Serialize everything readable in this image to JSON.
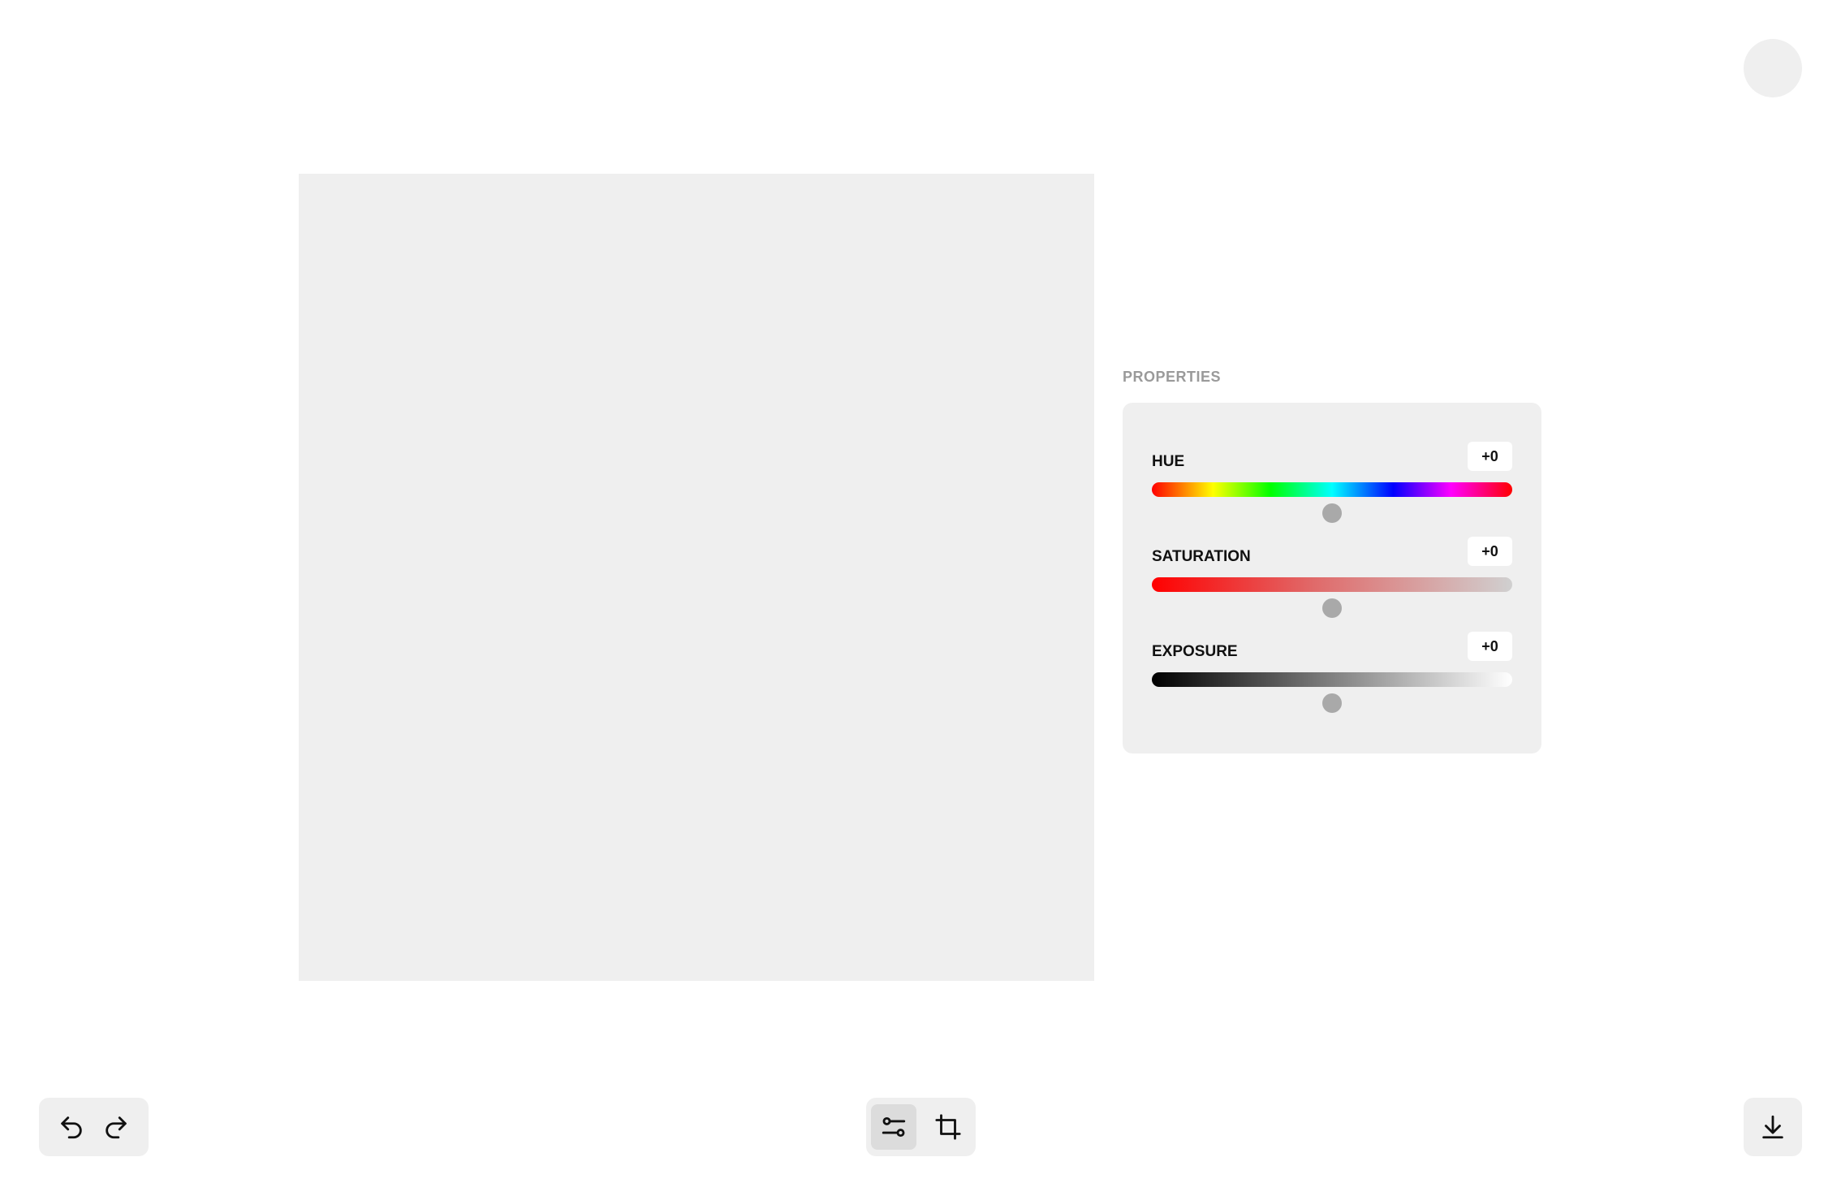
{
  "header": {
    "avatar_icon": "avatar-icon"
  },
  "properties": {
    "title": "PROPERTIES",
    "items": [
      {
        "label": "HUE",
        "value": "+0",
        "level": 0.5,
        "track": "hue-spectrum"
      },
      {
        "label": "SATURATION",
        "value": "+0",
        "level": 0.5,
        "track": "red-to-gray"
      },
      {
        "label": "EXPOSURE",
        "value": "+0",
        "level": 0.5,
        "track": "black-to-white"
      }
    ]
  },
  "toolbar": {
    "history": [
      {
        "icon": "undo-icon"
      },
      {
        "icon": "redo-icon"
      }
    ],
    "tools": [
      {
        "icon": "adjustments-icon",
        "active": true
      },
      {
        "icon": "crop-icon",
        "active": false
      }
    ],
    "export": {
      "icon": "download-icon"
    }
  },
  "colors": {
    "background": "#ffffff",
    "panel": "#efefef",
    "thumb": "#a9a9a9",
    "active_tool": "#dcdcdc",
    "title_text": "#9a9a9a"
  }
}
